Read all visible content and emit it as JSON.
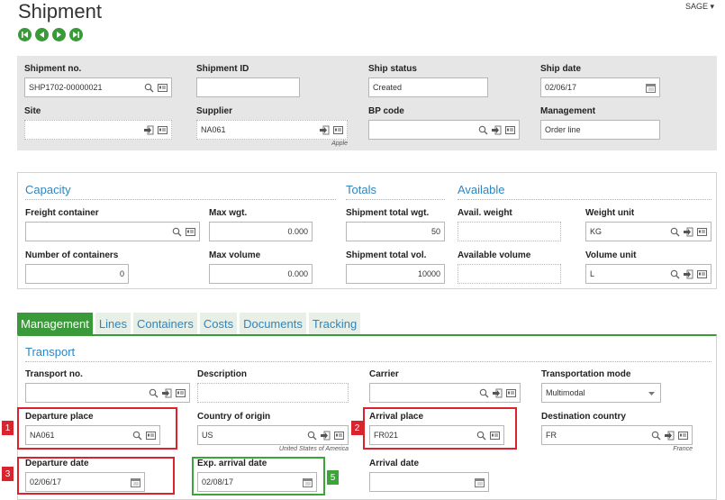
{
  "page": {
    "title": "Shipment",
    "user_menu": "SAGE"
  },
  "nav": [
    "first-record-icon",
    "previous-record-icon",
    "next-record-icon",
    "last-record-icon"
  ],
  "header": {
    "shipment_no": {
      "label": "Shipment no.",
      "value": "SHP1702-00000021"
    },
    "shipment_id": {
      "label": "Shipment ID",
      "value": ""
    },
    "ship_status": {
      "label": "Ship status",
      "value": "Created"
    },
    "ship_date": {
      "label": "Ship date",
      "value": "02/06/17"
    },
    "site": {
      "label": "Site",
      "value": ""
    },
    "supplier": {
      "label": "Supplier",
      "value": "NA061",
      "description": "Apple"
    },
    "bp_code": {
      "label": "BP code",
      "value": ""
    },
    "management": {
      "label": "Management",
      "value": "Order line"
    }
  },
  "capacity": {
    "title": "Capacity",
    "freight_container": {
      "label": "Freight container",
      "value": ""
    },
    "max_wgt": {
      "label": "Max wgt.",
      "value": "0.000"
    },
    "number_of_containers": {
      "label": "Number of containers",
      "value": "0"
    },
    "max_volume": {
      "label": "Max volume",
      "value": "0.000"
    }
  },
  "totals": {
    "title": "Totals",
    "total_wgt": {
      "label": "Shipment total wgt.",
      "value": "50"
    },
    "total_vol": {
      "label": "Shipment total vol.",
      "value": "10000"
    }
  },
  "available": {
    "title": "Available",
    "avail_weight": {
      "label": "Avail. weight",
      "value": ""
    },
    "weight_unit": {
      "label": "Weight unit",
      "value": "KG"
    },
    "available_volume": {
      "label": "Available volume",
      "value": ""
    },
    "volume_unit": {
      "label": "Volume unit",
      "value": "L"
    }
  },
  "tabs": [
    "Management",
    "Lines",
    "Containers",
    "Costs",
    "Documents",
    "Tracking"
  ],
  "transport": {
    "title": "Transport",
    "transport_no": {
      "label": "Transport no.",
      "value": ""
    },
    "description": {
      "label": "Description",
      "value": ""
    },
    "carrier": {
      "label": "Carrier",
      "value": ""
    },
    "transportation_mode": {
      "label": "Transportation mode",
      "value": "Multimodal"
    },
    "departure_place": {
      "label": "Departure place",
      "value": "NA061"
    },
    "country_of_origin": {
      "label": "Country of origin",
      "value": "US",
      "description": "United States of America"
    },
    "arrival_place": {
      "label": "Arrival place",
      "value": "FR021"
    },
    "destination_country": {
      "label": "Destination country",
      "value": "FR",
      "description": "France"
    },
    "departure_date": {
      "label": "Departure date",
      "value": "02/06/17"
    },
    "exp_arrival_date": {
      "label": "Exp. arrival date",
      "value": "02/08/17"
    },
    "arrival_date": {
      "label": "Arrival date",
      "value": ""
    }
  },
  "annotations": {
    "b1": "1",
    "b2": "2",
    "b3": "3",
    "b5": "5"
  },
  "colors": {
    "accent": "#3a9a3a",
    "link": "#2e86c1",
    "highlight_red": "#d9232d",
    "highlight_green": "#3aa63a"
  }
}
